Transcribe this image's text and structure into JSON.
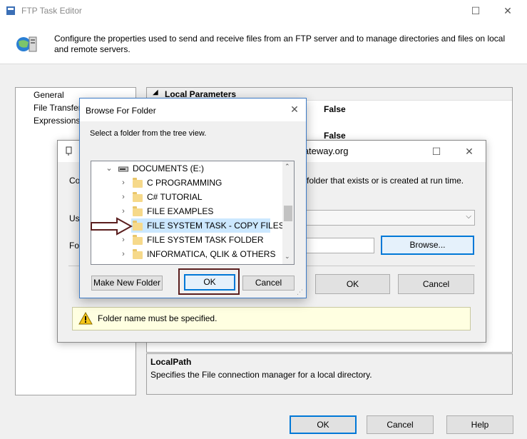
{
  "main": {
    "title": "FTP Task Editor",
    "description": "Configure the properties used to send and receive files from an FTP server and to manage directories and files on local and remote servers.",
    "nav": [
      "General",
      "File Transfer",
      "Expressions"
    ],
    "grid": {
      "section": "Local Parameters",
      "value1": "False",
      "value2": "False"
    },
    "desc_title": "LocalPath",
    "desc_text": "Specifies the File connection manager for a local directory.",
    "buttons": {
      "ok": "OK",
      "cancel": "Cancel",
      "help": "Help"
    }
  },
  "file_conn_dialog": {
    "partial_labels": {
      "co": "Co",
      "us": "Us",
      "fo": "Fo"
    },
    "hint_text": "folder that exists or is created at run time.",
    "browse_label": "Browse...",
    "ok_label": "OK",
    "cancel_label": "Cancel",
    "warning": "Folder name must be specified.",
    "watermark": "©tutorialgateway.org"
  },
  "browse_dialog": {
    "title": "Browse For Folder",
    "instruction": "Select a folder from the tree view.",
    "tree": [
      {
        "label": "DOCUMENTS (E:)",
        "type": "drive",
        "expanded": true
      },
      {
        "label": "C PROGRAMMING",
        "type": "folder"
      },
      {
        "label": "C# TUTORIAL",
        "type": "folder"
      },
      {
        "label": "FILE EXAMPLES",
        "type": "folder"
      },
      {
        "label": "FILE SYSTEM TASK - COPY FILES",
        "type": "folder",
        "selected": true
      },
      {
        "label": "FILE SYSTEM TASK FOLDER",
        "type": "folder"
      },
      {
        "label": "INFORMATICA, QLIK & OTHERS",
        "type": "folder"
      }
    ],
    "buttons": {
      "new_folder": "Make New Folder",
      "ok": "OK",
      "cancel": "Cancel"
    }
  },
  "colors": {
    "selection": "#cce8ff",
    "focus_border": "#0078d7",
    "annotation": "#5a1e1e",
    "warning_bg": "#ffffe1"
  }
}
